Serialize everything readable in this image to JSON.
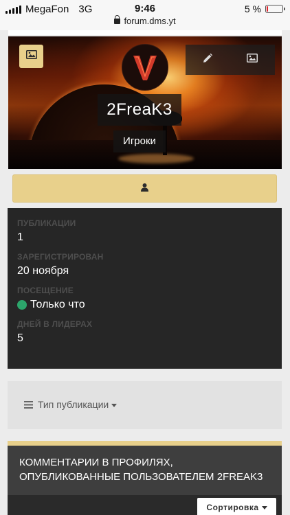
{
  "status_bar": {
    "carrier": "MegaFon",
    "network": "3G",
    "time": "9:46",
    "url": "forum.dms.yt",
    "battery": "5 %",
    "battery_level": 0.05
  },
  "profile": {
    "username": "2FreaK3",
    "group": "Игроки"
  },
  "stats": [
    {
      "label": "Публикации",
      "value": "1"
    },
    {
      "label": "Зарегистрирован",
      "value": "20 ноября"
    },
    {
      "label": "Посещение",
      "value": "Только что"
    },
    {
      "label": "Дней в лидерах",
      "value": "5"
    }
  ],
  "filter": {
    "label": "Тип публикации"
  },
  "comments": {
    "title": "Комментарии в профилях, опубликованные пользователем 2FreaK3",
    "sort_label": "Сортировка"
  },
  "colors": {
    "accent": "#e8d08b",
    "panel": "#262626",
    "online": "#2ca56b"
  },
  "icons": {
    "cover_photo": "image-icon",
    "edit": "pencil-icon",
    "photo": "image-icon",
    "follow": "user-icon",
    "filter": "list-icon"
  }
}
